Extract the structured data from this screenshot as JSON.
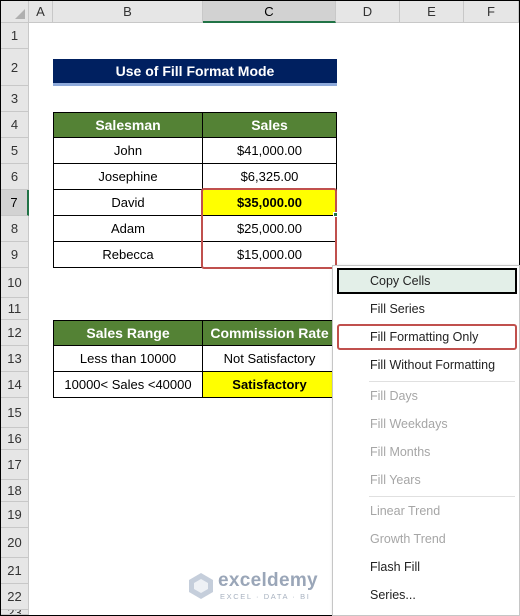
{
  "columns": [
    "A",
    "B",
    "C",
    "D",
    "E",
    "F"
  ],
  "rows": [
    "1",
    "2",
    "3",
    "4",
    "5",
    "6",
    "7",
    "8",
    "9",
    "10",
    "11",
    "12",
    "13",
    "14",
    "15",
    "16",
    "17",
    "18",
    "19",
    "20",
    "21",
    "22",
    "23"
  ],
  "title": "Use of Fill Format Mode",
  "table1": {
    "headers": [
      "Salesman",
      "Sales"
    ],
    "rows": [
      {
        "name": "John",
        "sales": "$41,000.00"
      },
      {
        "name": "Josephine",
        "sales": "$6,325.00"
      },
      {
        "name": "David",
        "sales": "$35,000.00"
      },
      {
        "name": "Adam",
        "sales": "$25,000.00"
      },
      {
        "name": "Rebecca",
        "sales": "$15,000.00"
      }
    ]
  },
  "table2": {
    "headers": [
      "Sales Range",
      "Commission Rate"
    ],
    "rows": [
      {
        "range": "Less than 10000",
        "rate": "Not Satisfactory"
      },
      {
        "range": "10000< Sales <40000",
        "rate": "Satisfactory"
      }
    ]
  },
  "menu": {
    "items": [
      {
        "label": "Copy Cells"
      },
      {
        "label": "Fill Series"
      },
      {
        "label": "Fill Formatting Only"
      },
      {
        "label": "Fill Without Formatting"
      },
      {
        "label": "Fill Days"
      },
      {
        "label": "Fill Weekdays"
      },
      {
        "label": "Fill Months"
      },
      {
        "label": "Fill Years"
      },
      {
        "label": "Linear Trend"
      },
      {
        "label": "Growth Trend"
      },
      {
        "label": "Flash Fill"
      },
      {
        "label": "Series..."
      }
    ]
  },
  "watermark": {
    "name": "exceldemy",
    "tagline": "EXCEL · DATA · BI"
  },
  "colors": {
    "title_bg": "#002060",
    "header_bg": "#548235",
    "highlight": "#ffff00",
    "selection": "#c0504d",
    "excel_green": "#217346"
  }
}
